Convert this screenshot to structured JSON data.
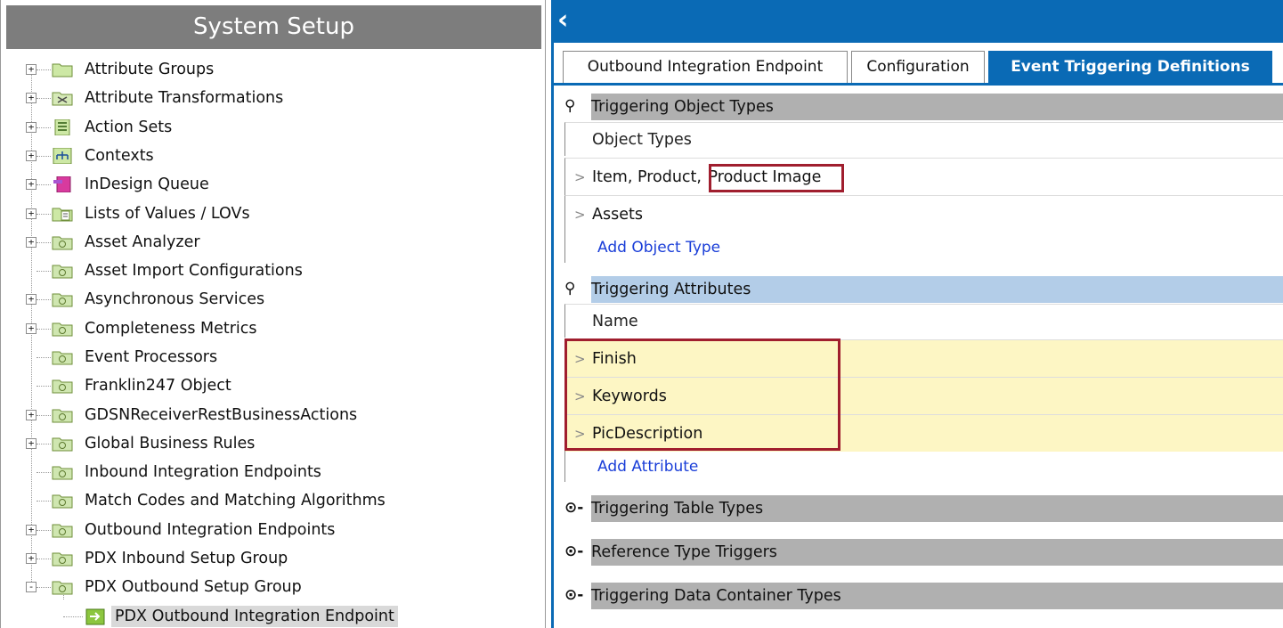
{
  "left_panel": {
    "title": "System Setup",
    "tree": [
      {
        "label": "Attribute Groups",
        "icon": "folder-icon",
        "toggle": "+"
      },
      {
        "label": "Attribute Transformations",
        "icon": "transformations-icon",
        "toggle": "+"
      },
      {
        "label": "Action Sets",
        "icon": "action-sets-icon",
        "toggle": "+"
      },
      {
        "label": "Contexts",
        "icon": "contexts-icon",
        "toggle": "+"
      },
      {
        "label": "InDesign Queue",
        "icon": "indesign-icon",
        "toggle": "+"
      },
      {
        "label": "Lists of Values / LOVs",
        "icon": "lov-icon",
        "toggle": "+"
      },
      {
        "label": "Asset Analyzer",
        "icon": "setup-folder-icon",
        "toggle": "+"
      },
      {
        "label": "Asset Import Configurations",
        "icon": "setup-folder-icon",
        "toggle": ""
      },
      {
        "label": "Asynchronous Services",
        "icon": "setup-folder-icon",
        "toggle": "+"
      },
      {
        "label": "Completeness Metrics",
        "icon": "setup-folder-icon",
        "toggle": "+"
      },
      {
        "label": "Event Processors",
        "icon": "setup-folder-icon",
        "toggle": ""
      },
      {
        "label": "Franklin247 Object",
        "icon": "setup-folder-icon",
        "toggle": ""
      },
      {
        "label": "GDSNReceiverRestBusinessActions",
        "icon": "setup-folder-icon",
        "toggle": "+"
      },
      {
        "label": "Global Business Rules",
        "icon": "setup-folder-icon",
        "toggle": "+"
      },
      {
        "label": "Inbound Integration Endpoints",
        "icon": "setup-folder-icon",
        "toggle": ""
      },
      {
        "label": "Match Codes and Matching Algorithms",
        "icon": "setup-folder-icon",
        "toggle": ""
      },
      {
        "label": "Outbound Integration Endpoints",
        "icon": "setup-folder-icon",
        "toggle": "+"
      },
      {
        "label": "PDX Inbound Setup Group",
        "icon": "setup-folder-icon",
        "toggle": "+"
      },
      {
        "label": "PDX Outbound Setup Group",
        "icon": "setup-folder-icon",
        "toggle": "-"
      },
      {
        "label": "PDX Outbound Integration Endpoint",
        "icon": "endpoint-icon",
        "toggle": "",
        "selected": true
      }
    ]
  },
  "right_panel": {
    "tabs": [
      {
        "label": "Outbound Integration Endpoint",
        "active": false
      },
      {
        "label": "Configuration",
        "active": false
      },
      {
        "label": "Event Triggering Definitions",
        "active": true
      }
    ],
    "triggering_object_types": {
      "title": "Triggering Object Types",
      "column_header": "Object Types",
      "rows": [
        "Item, Product, ",
        "Assets"
      ],
      "highlighted_text": "Product Image",
      "add_link": "Add Object Type"
    },
    "triggering_attributes": {
      "title": "Triggering Attributes",
      "column_header": "Name",
      "rows": [
        "Finish",
        "Keywords",
        "PicDescription"
      ],
      "add_link": "Add Attribute"
    },
    "collapsed_sections": [
      "Triggering Table Types",
      "Reference Type Triggers",
      "Triggering Data Container Types"
    ]
  },
  "colors": {
    "brand_blue": "#0a6ab5",
    "highlight_yellow": "#fdf6c4",
    "section_gray": "#b0b0b0",
    "section_blue": "#b3cde8",
    "callout_red": "#a01e2e",
    "link_blue": "#1a3ed8"
  }
}
